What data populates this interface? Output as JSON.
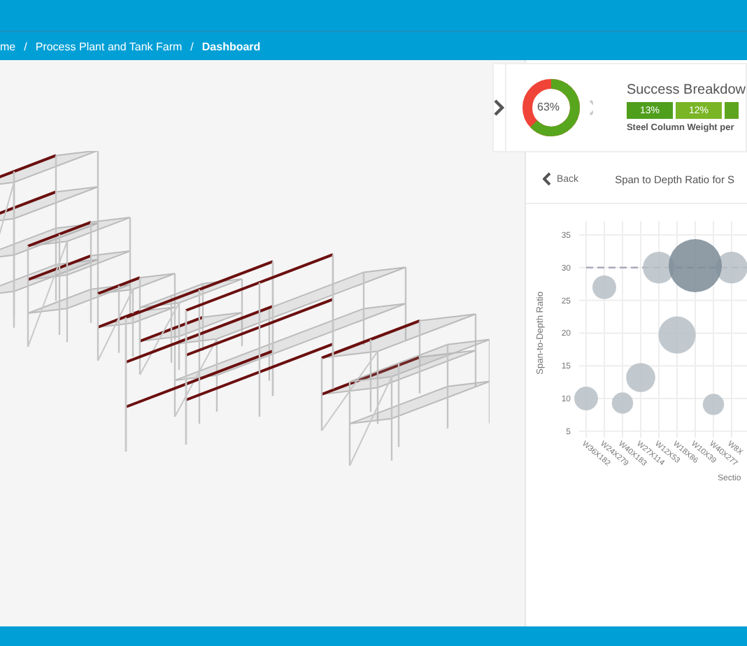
{
  "breadcrumb": [
    {
      "label": "me",
      "current": false
    },
    {
      "separator": "/",
      "label": "Process Plant and Tank Farm",
      "current": false
    },
    {
      "separator": "/",
      "label": "Dashboard",
      "current": true
    }
  ],
  "viewer": {
    "kind": "model"
  },
  "summary": {
    "donut": {
      "level": 0.63,
      "label": "63%"
    },
    "title": "Success Breakdow",
    "segments": [
      {
        "label": "13%",
        "color": "#4f9e1c"
      },
      {
        "label": "12%",
        "color": "#7ab526"
      },
      {
        "color": "#5ea51f"
      }
    ],
    "caption": "Steel Column Weight per"
  },
  "detail": {
    "back": "Back",
    "title": "Span to Depth Ratio for S",
    "chart_data": {
      "type": "scatter",
      "xlabel": "Sectio",
      "ylabel": "Span-to-Depth Ratio",
      "grid": true,
      "categories": [
        "W36X182",
        "W24X279",
        "W40X183",
        "W27X114",
        "W12X53",
        "W18X86",
        "W10X39",
        "W40X277",
        "W8X"
      ],
      "yticks": [
        5,
        10,
        15,
        20,
        25,
        30,
        35
      ],
      "ylim": [
        5,
        35
      ],
      "series": [
        {
          "color": "#b7c0c6",
          "values": [
            10,
            27,
            9.3,
            13.2,
            30,
            19.7,
            null,
            9.1,
            30
          ],
          "sizes": [
            0.2,
            0.2,
            0.16,
            0.3,
            0.36,
            0.49,
            null,
            0.16,
            0.36
          ]
        },
        {
          "color": "#7b8b97",
          "values": [
            null,
            null,
            null,
            null,
            null,
            null,
            30.3,
            null,
            null
          ],
          "sizes": [
            null,
            null,
            null,
            null,
            null,
            null,
            1,
            null,
            null
          ]
        }
      ],
      "ref_lines": [
        {
          "axis": "y",
          "value": 30
        }
      ]
    }
  }
}
